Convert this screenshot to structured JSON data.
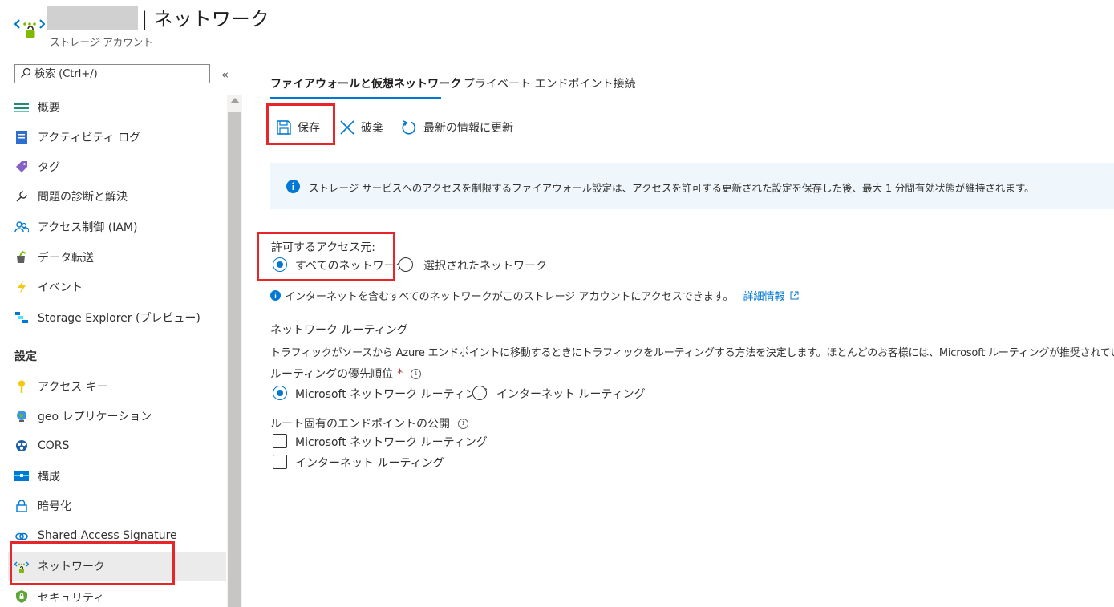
{
  "header": {
    "title": "| ネットワーク",
    "subtitle": "ストレージ アカウント"
  },
  "sidebar": {
    "search_placeholder": "検索 (Ctrl+/)",
    "collapse_glyph": "«",
    "items": [
      {
        "label": "概要",
        "icon": "overview-icon"
      },
      {
        "label": "アクティビティ ログ",
        "icon": "activity-log-icon"
      },
      {
        "label": "タグ",
        "icon": "tag-icon"
      },
      {
        "label": "問題の診断と解決",
        "icon": "wrench-icon"
      },
      {
        "label": "アクセス制御 (IAM)",
        "icon": "people-icon"
      },
      {
        "label": "データ転送",
        "icon": "data-transfer-icon"
      },
      {
        "label": "イベント",
        "icon": "lightning-icon"
      },
      {
        "label": "Storage Explorer (プレビュー)",
        "icon": "storage-explorer-icon"
      }
    ],
    "section_settings": "設定",
    "settings_items": [
      {
        "label": "アクセス キー",
        "icon": "key-icon"
      },
      {
        "label": "geo レプリケーション",
        "icon": "globe-icon"
      },
      {
        "label": "CORS",
        "icon": "cors-icon"
      },
      {
        "label": "構成",
        "icon": "configuration-icon"
      },
      {
        "label": "暗号化",
        "icon": "lock-icon"
      },
      {
        "label": "Shared Access Signature",
        "icon": "link-icon"
      },
      {
        "label": "ネットワーク",
        "icon": "network-icon",
        "selected": true
      },
      {
        "label": "セキュリティ",
        "icon": "shield-icon"
      }
    ]
  },
  "tabs": [
    {
      "label": "ファイアウォールと仮想ネットワーク",
      "active": true
    },
    {
      "label": "プライベート エンドポイント接続",
      "active": false
    }
  ],
  "toolbar": {
    "save": "保存",
    "discard": "破棄",
    "refresh": "最新の情報に更新"
  },
  "banner": {
    "text": "ストレージ サービスへのアクセスを制限するファイアウォール設定は、アクセスを許可する更新された設定を保存した後、最大 1 分間有効状態が維持されます。"
  },
  "access": {
    "label": "許可するアクセス元:",
    "options": [
      "すべてのネットワーク",
      "選択されたネットワーク"
    ],
    "selected": "すべてのネットワーク",
    "info": "インターネットを含むすべてのネットワークがこのストレージ アカウントにアクセスできます。",
    "learn_more": "詳細情報"
  },
  "routing": {
    "title": "ネットワーク ルーティング",
    "description": "トラフィックがソースから Azure エンドポイントに移動するときにトラフィックをルーティングする方法を決定します。ほとんどのお客様には、Microsoft ルーティングが推奨されています。",
    "preference_label": "ルーティングの優先順位",
    "required_mark": "*",
    "options": [
      "Microsoft ネットワーク ルーティング",
      "インターネット ルーティング"
    ],
    "selected": "Microsoft ネットワーク ルーティング",
    "publish_label": "ルート固有のエンドポイントの公開",
    "publish_options": [
      "Microsoft ネットワーク ルーティング",
      "インターネット ルーティング"
    ]
  },
  "colors": {
    "accent": "#0078d4",
    "highlight": "#e8262a",
    "banner_bg": "#eff6fc"
  }
}
